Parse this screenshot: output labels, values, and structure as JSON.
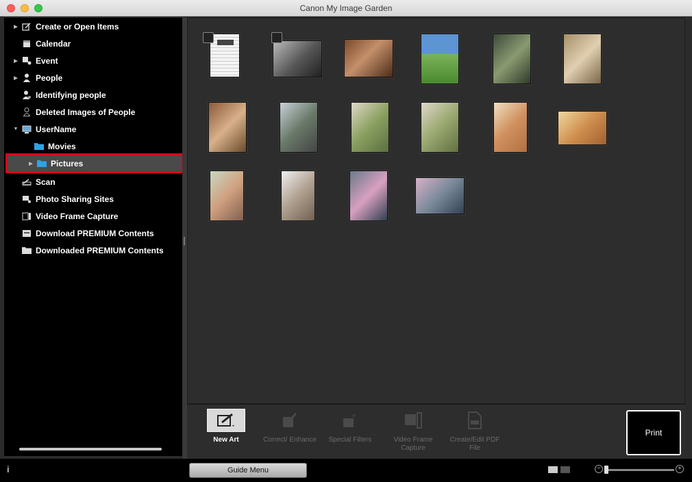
{
  "window": {
    "title": "Canon My Image Garden"
  },
  "sidebar": {
    "items": [
      {
        "label": "Create or Open Items",
        "expandable": true,
        "icon": "create-items-icon"
      },
      {
        "label": "Calendar",
        "expandable": false,
        "icon": "calendar-icon"
      },
      {
        "label": "Event",
        "expandable": true,
        "icon": "event-icon"
      },
      {
        "label": "People",
        "expandable": true,
        "icon": "people-icon"
      },
      {
        "label": "Identifying people",
        "expandable": false,
        "icon": "identifying-people-icon"
      },
      {
        "label": "Deleted Images of People",
        "expandable": false,
        "icon": "deleted-people-icon"
      },
      {
        "label": "UserName",
        "expandable": true,
        "expanded": true,
        "icon": "computer-icon"
      },
      {
        "label": "Movies",
        "expandable": false,
        "icon": "folder-icon"
      },
      {
        "label": "Pictures",
        "expandable": true,
        "selected": true,
        "icon": "folder-icon"
      },
      {
        "label": "Scan",
        "expandable": false,
        "icon": "scan-icon"
      },
      {
        "label": "Photo Sharing Sites",
        "expandable": false,
        "icon": "photo-sharing-icon"
      },
      {
        "label": "Video Frame Capture",
        "expandable": false,
        "icon": "video-frame-icon"
      },
      {
        "label": "Download PREMIUM Contents",
        "expandable": false,
        "icon": "download-icon"
      },
      {
        "label": "Downloaded PREMIUM Contents",
        "expandable": false,
        "icon": "downloaded-icon"
      }
    ]
  },
  "toolbar": {
    "new_art": "New Art",
    "correct_enhance": "Correct/ Enhance",
    "special_filters": "Special Filters",
    "video_frame_capture": "Video Frame Capture",
    "create_edit_pdf": "Create/Edit PDF File",
    "print": "Print"
  },
  "statusbar": {
    "info": "i",
    "guide_menu": "Guide Menu"
  },
  "colors": {
    "selection_outline": "#e3001b",
    "folder_blue": "#2ea3e6"
  }
}
